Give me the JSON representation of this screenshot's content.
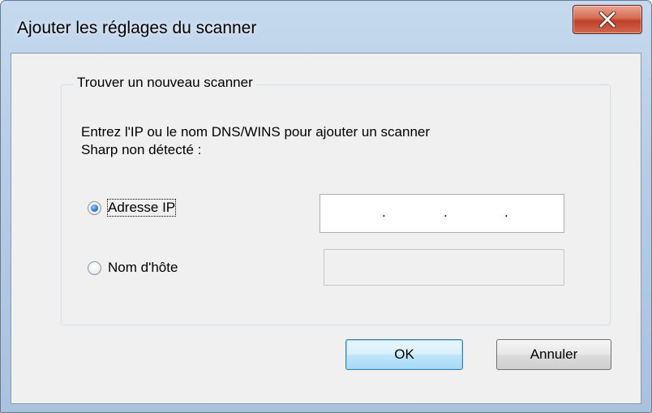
{
  "window": {
    "title": "Ajouter les réglages du scanner",
    "close_icon": "close-x-icon"
  },
  "group": {
    "title": "Trouver un nouveau scanner",
    "description_line1": "Entrez l'IP ou le nom DNS/WINS pour ajouter un scanner",
    "description_line2": "Sharp non détecté :"
  },
  "options": {
    "ip_label": "Adresse IP",
    "ip_selected": true,
    "host_label": "Nom d'hôte",
    "host_selected": false
  },
  "fields": {
    "ip_value": "",
    "ip_separators": [
      ".",
      ".",
      "."
    ],
    "host_value": "",
    "host_enabled": false
  },
  "buttons": {
    "ok_label": "OK",
    "cancel_label": "Annuler"
  },
  "colors": {
    "close_button": "#c0402a",
    "default_button_border": "#3c7fb1"
  }
}
